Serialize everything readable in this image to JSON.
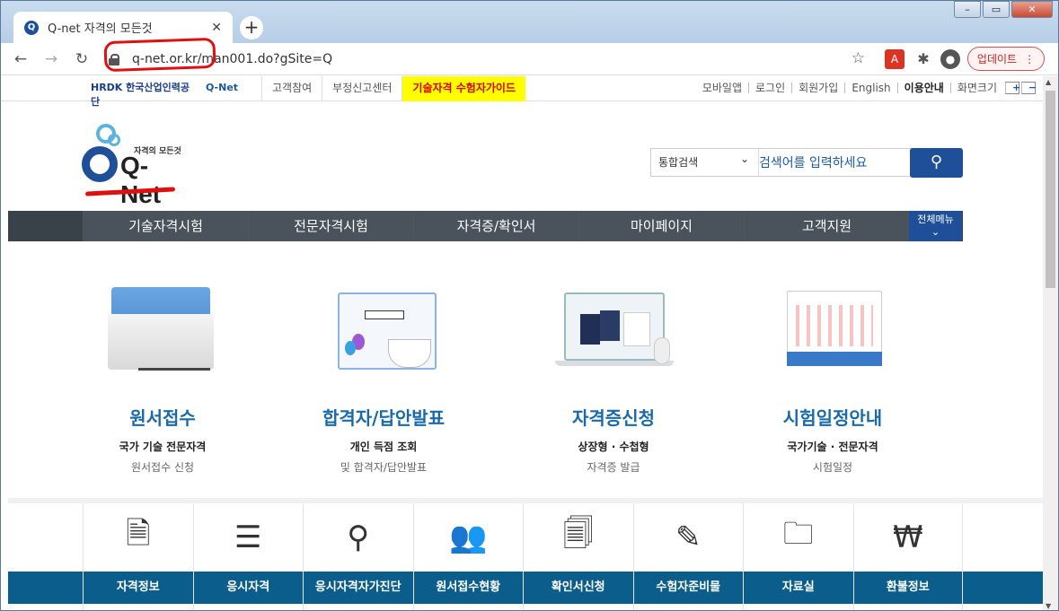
{
  "browser": {
    "tab_title": "Q-net 자격의 모든것",
    "tab_favicon": "Q",
    "url": "q-net.or.kr/man001.do?gSite=Q",
    "update_label": "업데이트"
  },
  "util": {
    "hrdk_logo": "HRDK 한국산업인력공단",
    "qnet_logo": "Q-Net",
    "left_links": [
      "고객참여",
      "부정신고센터",
      "기술자격 수험자가이드"
    ],
    "right_links": [
      "모바일앱",
      "로그인",
      "회원가입",
      "English",
      "이용안내",
      "화면크기"
    ]
  },
  "logo": {
    "tagline": "자격의 모든것",
    "name": "Q-Net"
  },
  "search": {
    "select_value": "통합검색",
    "placeholder": "검색어를 입력하세요"
  },
  "gnb": {
    "items": [
      "기술자격시험",
      "전문자격시험",
      "자격증/확인서",
      "마이페이지",
      "고객지원"
    ],
    "all_menu": "전체메뉴"
  },
  "cards": [
    {
      "title": "원서접수",
      "sub1": "국가 기술 전문자격",
      "sub2": "원서접수 신청"
    },
    {
      "title": "합격자/답안발표",
      "sub1": "개인 득점 조회",
      "sub2": "및 합격자/답안발표"
    },
    {
      "title": "자격증신청",
      "sub1": "상장형 · 수첩형",
      "sub2": "자격증 발급"
    },
    {
      "title": "시험일정안내",
      "sub1": "국가기술 · 전문자격",
      "sub2": "시험일정"
    }
  ],
  "quick_links": [
    {
      "label": "자격정보",
      "icon": "document-info-icon"
    },
    {
      "label": "응시자격",
      "icon": "checklist-icon"
    },
    {
      "label": "응시자격자가진단",
      "icon": "magnifier-icon"
    },
    {
      "label": "원서접수현황",
      "icon": "people-icon"
    },
    {
      "label": "확인서신청",
      "icon": "document-return-icon"
    },
    {
      "label": "수험자준비물",
      "icon": "pencil-icon"
    },
    {
      "label": "자료실",
      "icon": "folder-icon"
    },
    {
      "label": "환불정보",
      "icon": "money-icon"
    }
  ]
}
